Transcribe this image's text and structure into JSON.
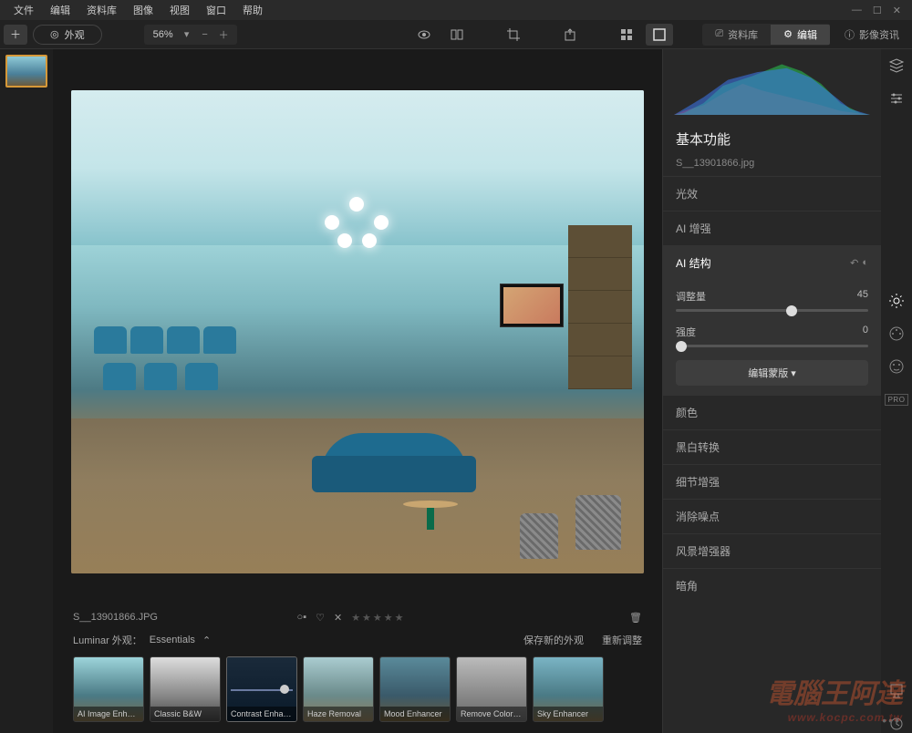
{
  "menu": {
    "items": [
      "文件",
      "编辑",
      "资料库",
      "图像",
      "视图",
      "窗口",
      "帮助"
    ]
  },
  "toolbar": {
    "look_label": "外观",
    "zoom": "56%",
    "tabs": {
      "library": "资料库",
      "edit": "编辑"
    },
    "info_label": "影像资讯"
  },
  "filename": "S__13901866.jpg",
  "filename_upper": "S__13901866.JPG",
  "panel": {
    "title": "基本功能",
    "light": "光效",
    "ai_enhance": "AI 增强",
    "ai_struct": {
      "title": "AI 结构",
      "p1_label": "调整量",
      "p1_value": "45",
      "p2_label": "强度",
      "p2_value": "0",
      "mask_btn": "编辑蒙版 ▾"
    },
    "tools": [
      "颜色",
      "黑白转换",
      "细节增强",
      "消除噪点",
      "风景增强器",
      "暗角"
    ]
  },
  "looks": {
    "label": "Luminar 外观：",
    "category": "Essentials",
    "save_new": "保存新的外观",
    "reset": "重新调整",
    "presets": [
      "AI Image Enhan…",
      "Classic B&W",
      "Contrast Enhan…",
      "Haze Removal",
      "Mood Enhancer",
      "Remove Color…",
      "Sky Enhancer"
    ]
  },
  "pro_badge": "PRO",
  "chart_data": {
    "type": "area",
    "title": "RGB Histogram",
    "xlabel": "",
    "ylabel": "",
    "x": [
      0,
      32,
      64,
      96,
      128,
      160,
      192,
      224,
      255
    ],
    "series": [
      {
        "name": "R",
        "values": [
          2,
          8,
          20,
          35,
          25,
          18,
          10,
          3,
          0
        ]
      },
      {
        "name": "G",
        "values": [
          1,
          6,
          22,
          40,
          50,
          70,
          45,
          12,
          1
        ]
      },
      {
        "name": "B",
        "values": [
          3,
          10,
          28,
          45,
          55,
          60,
          35,
          8,
          0
        ]
      }
    ],
    "xlim": [
      0,
      255
    ],
    "ylim": [
      0,
      80
    ]
  }
}
